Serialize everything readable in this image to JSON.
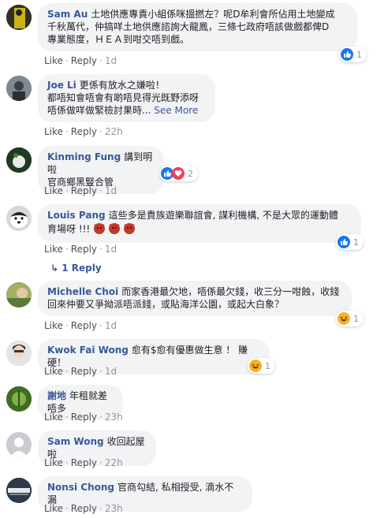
{
  "comments": [
    {
      "name": "Sam Au",
      "lines": [
        "土地供應專責小組係咪搵撚左？呢D牟利會所佔用土地變成",
        "千秋萬代，仲搞咩土地供應諮詢大龍鳳，三條七政府唔該做戲都俾D",
        "專業態度，ＨＥＡ到咁交唔到戲。"
      ],
      "like": "Like",
      "reply": "Reply",
      "time": "1d",
      "react_count": "1"
    },
    {
      "name": "Joe Li",
      "lines": [
        "更係有放水之嫌啦！",
        "都唔知會唔會有啲唔見得光既野添呀",
        "唔係做咩做緊檢討果時..."
      ],
      "see_more": "See More",
      "like": "Like",
      "reply": "Reply",
      "time": "22h"
    },
    {
      "name": "Kinming Fung",
      "lines": [
        "講到明啦",
        "官商鄉黑豎合管"
      ],
      "like": "Like",
      "reply": "Reply",
      "time": "1d",
      "react_count": "2"
    },
    {
      "name": "Louis Pang",
      "lines": [
        "這些多是貴族遊樂聯誼會, 謀利機構, 不是大眾的運動體",
        "育場呀 !!!"
      ],
      "like": "Like",
      "reply": "Reply",
      "time": "1d",
      "react_count": "1",
      "replies_label": "1 Reply"
    },
    {
      "name": "Michelle Choi",
      "lines": [
        "而家香港最欠地，唔係最欠錢，收三分一咁蝕，收錢",
        "回來仲要又爭拗派唔派錢，或貼海洋公園，或起大白象？"
      ],
      "like": "Like",
      "reply": "Reply",
      "time": "1d",
      "react_count": "1"
    },
    {
      "name": "Kwok Fai Wong",
      "lines": [
        "愈有$愈有優惠做生意 ！ 賺硬！"
      ],
      "like": "Like",
      "reply": "Reply",
      "time": "1d",
      "react_count": "1"
    },
    {
      "name": "謝地",
      "lines": [
        "年租就差唔多"
      ],
      "like": "Like",
      "reply": "Reply",
      "time": "23h"
    },
    {
      "name": "Sam Wong",
      "lines": [
        "收回起屋啦"
      ],
      "like": "Like",
      "reply": "Reply",
      "time": "22h"
    },
    {
      "name": "Nonsi Chong",
      "lines": [
        "官商勾結, 私相授受, 滴水不漏"
      ],
      "like": "Like",
      "reply": "Reply",
      "time": "23h"
    }
  ],
  "colors": {
    "link": "#385898",
    "bubble": "#f2f3f5",
    "meta": "#90949c",
    "like_blue": "#1877f2",
    "love_red": "#f33e58",
    "haha_yellow": "#f7b125"
  }
}
